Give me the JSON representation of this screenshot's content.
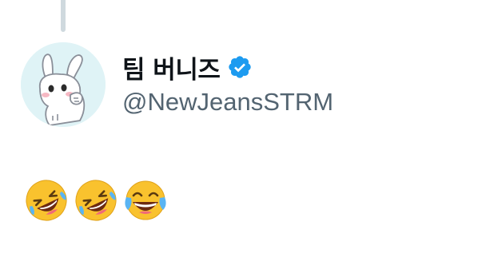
{
  "author": {
    "display_name": "팀 버니즈",
    "handle": "@NewJeansSTRM",
    "verified": true,
    "avatar_icon": "bunny-avatar-icon",
    "verified_icon": "verified-badge-icon"
  },
  "tweet": {
    "emojis": [
      {
        "icon": "rolling-on-floor-laughing-emoji",
        "char": "🤣"
      },
      {
        "icon": "rolling-on-floor-laughing-emoji",
        "char": "🤣"
      },
      {
        "icon": "face-with-tears-of-joy-emoji",
        "char": "😂"
      }
    ]
  },
  "colors": {
    "text_primary": "#0f1419",
    "text_secondary": "#536471",
    "verified_blue": "#1d9bf0",
    "thread_line": "#cfd9de",
    "avatar_bg": "#dff3f6",
    "emoji_yellow": "#f9c22e"
  }
}
